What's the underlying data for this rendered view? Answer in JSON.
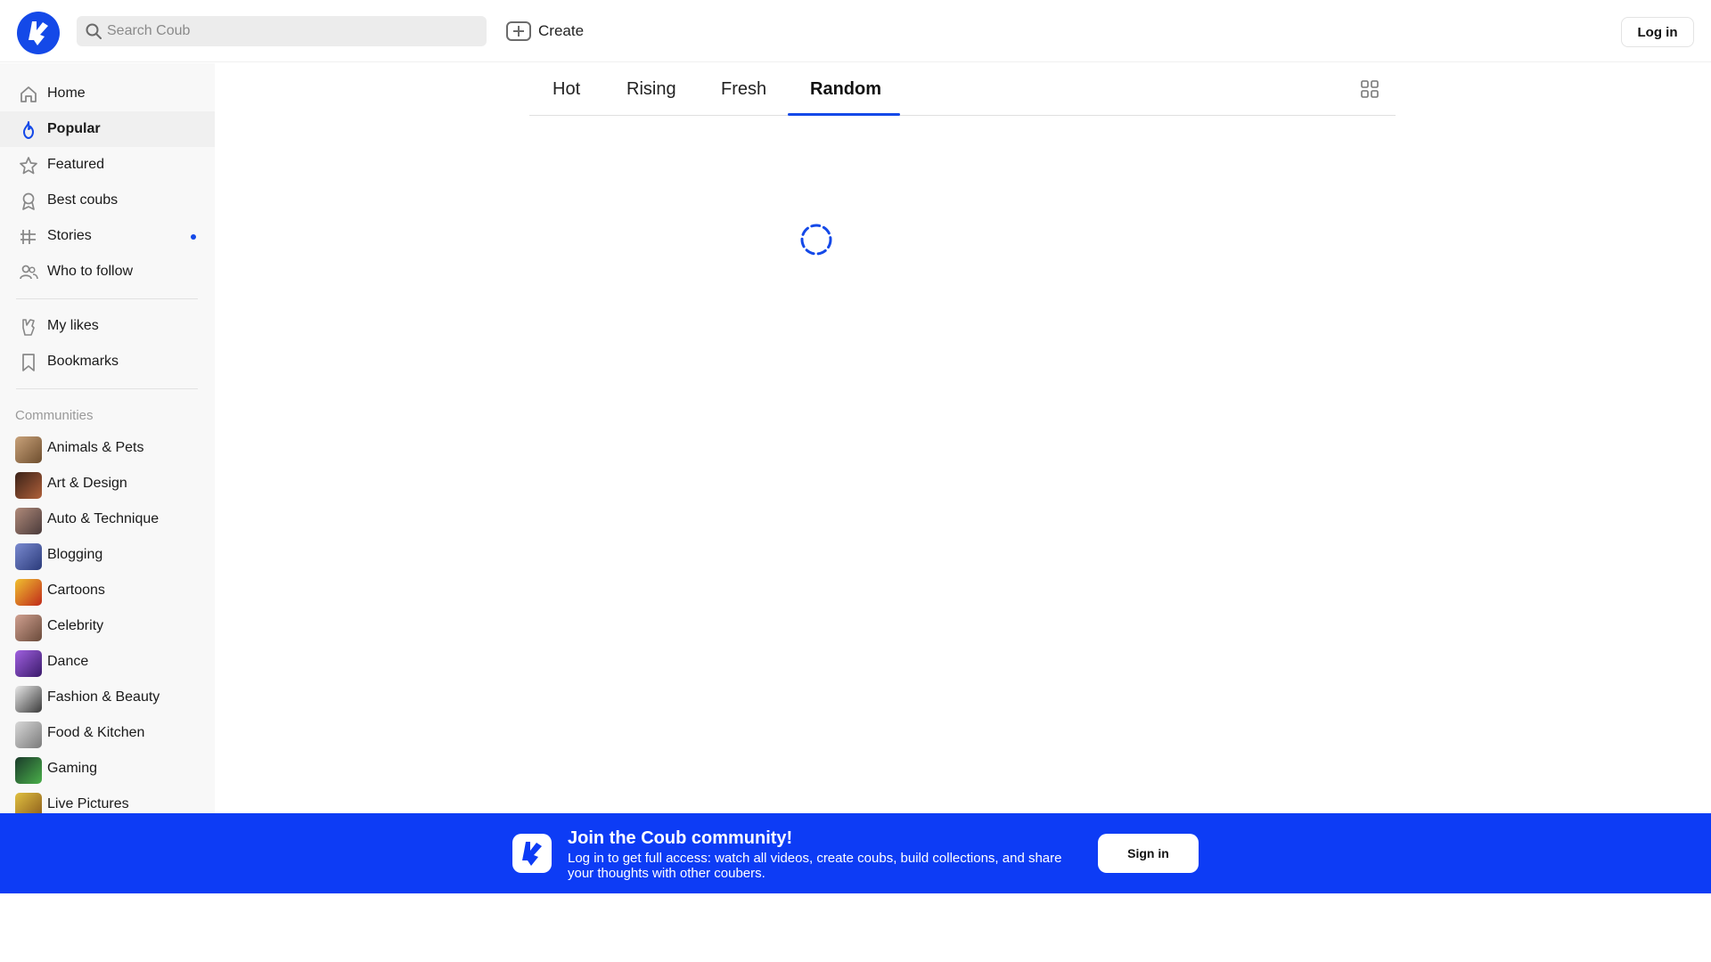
{
  "header": {
    "logo": "coub-logo-icon",
    "search_placeholder": "Search Coub",
    "create_label": "Create",
    "login_label": "Log in"
  },
  "sidebar": {
    "nav": [
      {
        "label": "Home",
        "icon": "home-icon",
        "active": false
      },
      {
        "label": "Popular",
        "icon": "flame-icon",
        "active": true
      },
      {
        "label": "Featured",
        "icon": "star-icon",
        "active": false
      },
      {
        "label": "Best coubs",
        "icon": "award-icon",
        "active": false
      },
      {
        "label": "Stories",
        "icon": "stories-icon",
        "active": false,
        "badge_dot": true
      },
      {
        "label": "Who to follow",
        "icon": "users-icon",
        "active": false
      }
    ],
    "personal": [
      {
        "label": "My likes",
        "icon": "like-hand-icon"
      },
      {
        "label": "Bookmarks",
        "icon": "bookmark-icon"
      }
    ],
    "communities_title": "Communities",
    "communities": [
      {
        "label": "Animals & Pets",
        "color": "#8a6a4a"
      },
      {
        "label": "Art & Design",
        "color": "#5a3a2a"
      },
      {
        "label": "Auto & Technique",
        "color": "#7a5a5a"
      },
      {
        "label": "Blogging",
        "color": "#4a5aa0"
      },
      {
        "label": "Cartoons",
        "color": "#d0662a"
      },
      {
        "label": "Celebrity",
        "color": "#a07060"
      },
      {
        "label": "Dance",
        "color": "#7a3ab0"
      },
      {
        "label": "Fashion & Beauty",
        "color": "#c8c8c8"
      },
      {
        "label": "Food & Kitchen",
        "color": "#b0b0b0"
      },
      {
        "label": "Gaming",
        "color": "#2a6a3a"
      },
      {
        "label": "Live Pictures",
        "color": "#c8a020"
      }
    ]
  },
  "main": {
    "tabs": [
      {
        "label": "Hot",
        "active": false
      },
      {
        "label": "Rising",
        "active": false
      },
      {
        "label": "Fresh",
        "active": false
      },
      {
        "label": "Random",
        "active": true
      }
    ],
    "view_toggle_icon": "grid-view-icon",
    "loading": true
  },
  "banner": {
    "title": "Join the Coub community!",
    "text": "Log in to get full access: watch all videos, create coubs, build collections, and share your thoughts with other coubers.",
    "button_label": "Sign in"
  },
  "colors": {
    "accent": "#1449e8",
    "banner_bg": "#0d3cf5",
    "sidebar_bg": "#f8f8f8"
  }
}
